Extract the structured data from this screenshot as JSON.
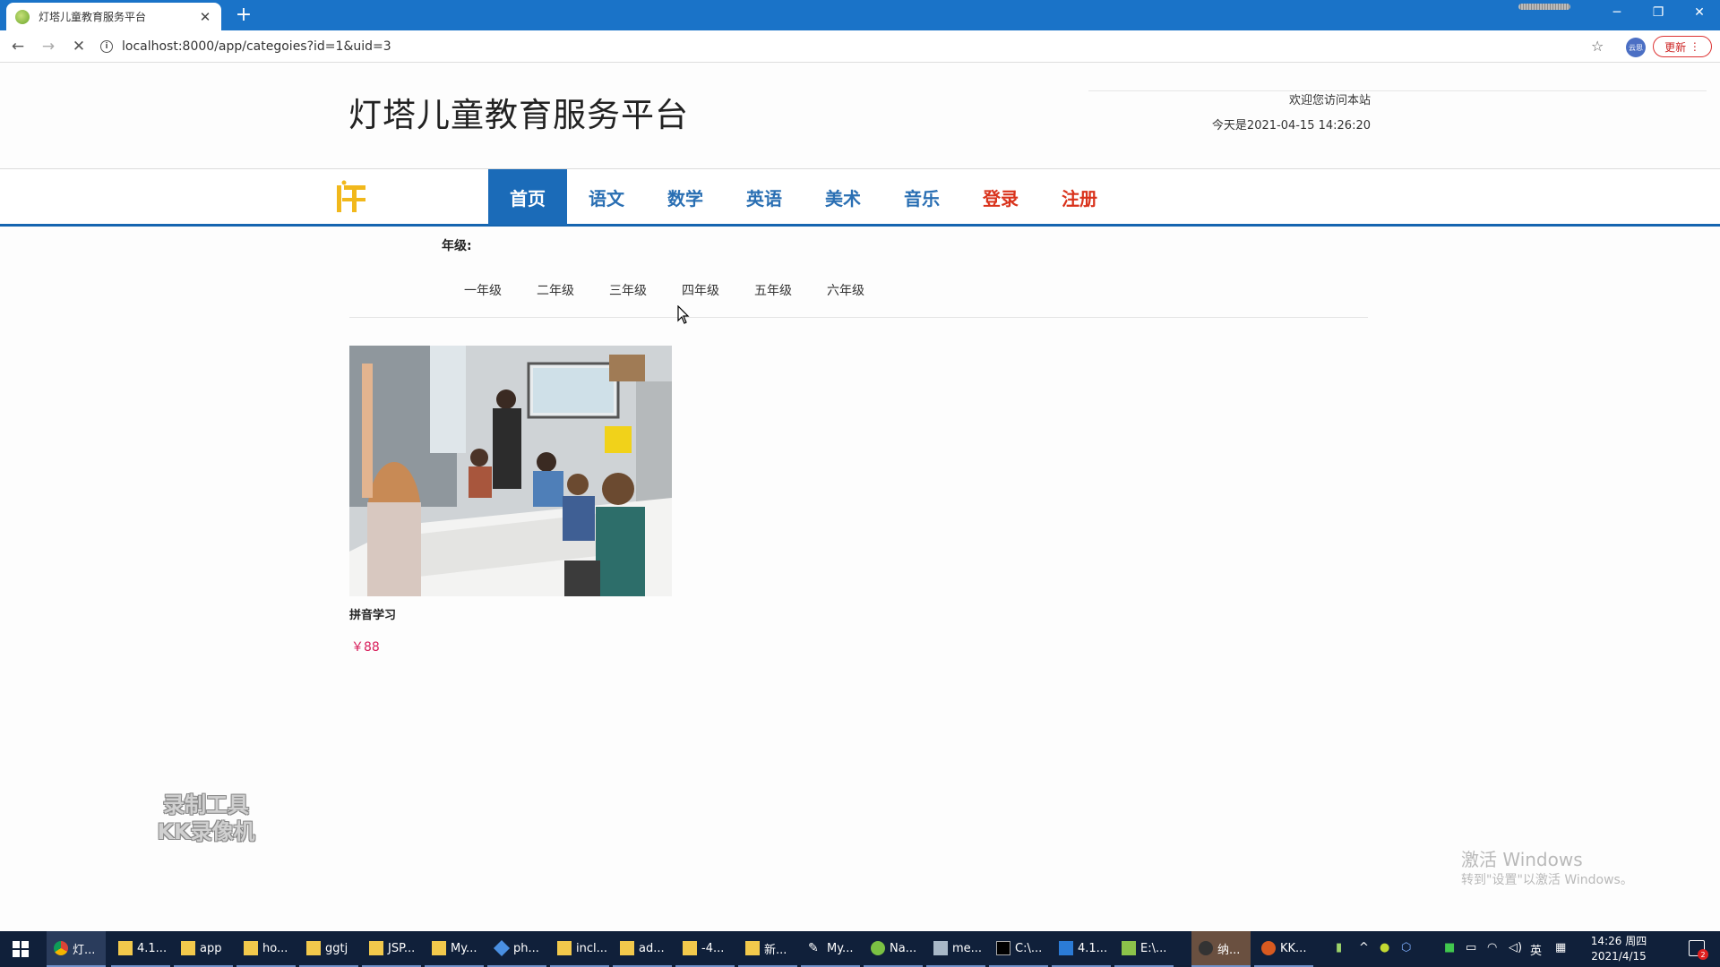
{
  "browser": {
    "tab_title": "灯塔儿童教育服务平台",
    "url": "localhost:8000/app/categoies?id=1&uid=3",
    "update_label": "更新",
    "profile_label": "云思"
  },
  "header": {
    "site_title": "灯塔儿童教育服务平台",
    "welcome": "欢迎您访问本站",
    "today": "今天是2021-04-15 14:26:20"
  },
  "nav": {
    "items": [
      {
        "label": "首页"
      },
      {
        "label": "语文"
      },
      {
        "label": "数学"
      },
      {
        "label": "英语"
      },
      {
        "label": "美术"
      },
      {
        "label": "音乐"
      },
      {
        "label": "登录"
      },
      {
        "label": "注册"
      }
    ]
  },
  "filter": {
    "grade_label": "年级:",
    "grades": [
      "一年级",
      "二年级",
      "三年级",
      "四年级",
      "五年级",
      "六年级"
    ]
  },
  "products": [
    {
      "name": "拼音学习",
      "price": "￥88"
    }
  ],
  "overlay": {
    "watermark_line1": "录制工具",
    "watermark_line2": "KK录像机",
    "activate_title": "激活 Windows",
    "activate_sub": "转到\"设置\"以激活 Windows。"
  },
  "taskbar": {
    "items": [
      "灯...",
      "4.1...",
      "app",
      "ho...",
      "ggtj",
      "JSP...",
      "My...",
      "ph...",
      "incl...",
      "ad...",
      "-4...",
      "新...",
      "My...",
      "Na...",
      "me...",
      "C:\\...",
      "4.1...",
      "E:\\...",
      "纳...",
      "KK..."
    ],
    "ime": "英",
    "time": "14:26 周四",
    "date": "2021/4/15",
    "notification_count": "2"
  },
  "colors": {
    "browser_accent": "#1a73c8",
    "nav_blue": "#1b6bb8",
    "nav_red": "#d9331c",
    "price": "#d81e5b",
    "taskbar": "#10203a"
  }
}
